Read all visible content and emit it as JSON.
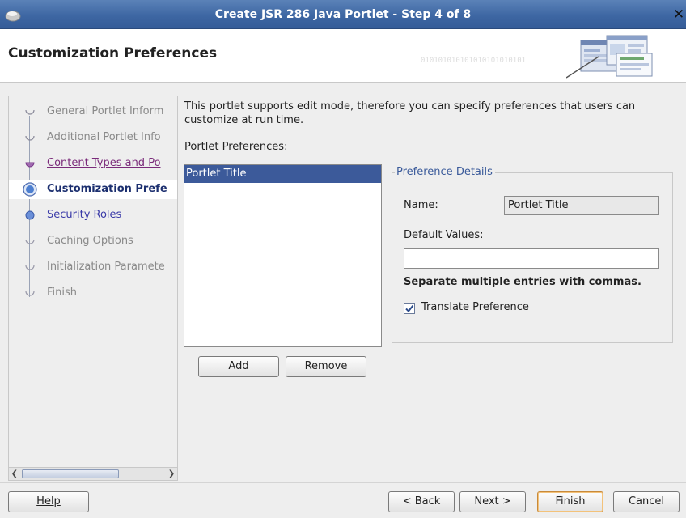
{
  "window": {
    "title": "Create JSR 286 Java Portlet - Step 4 of 8",
    "close_glyph": "✕"
  },
  "header": {
    "title": "Customization Preferences",
    "binary_text": "010101010101010101010101"
  },
  "steps": [
    {
      "label": "General Portlet Inform",
      "state": "done"
    },
    {
      "label": "Additional Portlet Info",
      "state": "done"
    },
    {
      "label": "Content Types and Po",
      "state": "visited"
    },
    {
      "label": "Customization Prefe",
      "state": "current"
    },
    {
      "label": "Security Roles",
      "state": "link"
    },
    {
      "label": "Caching Options",
      "state": "future"
    },
    {
      "label": "Initialization Paramete",
      "state": "future"
    },
    {
      "label": "Finish",
      "state": "future"
    }
  ],
  "main": {
    "description": "This portlet supports edit mode, therefore you can specify preferences that users can customize at run time.",
    "preferences_label": "Portlet Preferences:",
    "preferences": [
      "Portlet Title"
    ],
    "add_label": "Add",
    "remove_label": "Remove"
  },
  "details": {
    "legend": "Preference Details",
    "name_label": "Name:",
    "name_value": "Portlet Title",
    "default_values_label": "Default Values:",
    "default_values_value": "",
    "hint": "Separate multiple entries with commas.",
    "translate_label": "Translate Preference",
    "translate_checked": true
  },
  "footer": {
    "help": "Help",
    "back": "< Back",
    "next": "Next >",
    "finish": "Finish",
    "cancel": "Cancel"
  },
  "colors": {
    "titlebar": "#3e67a3",
    "selection": "#3c5a9a",
    "current_step_text": "#1c2f6f",
    "link": "#3a3aa8",
    "visited_link": "#7a2a7a",
    "legend": "#3a5a9a"
  }
}
